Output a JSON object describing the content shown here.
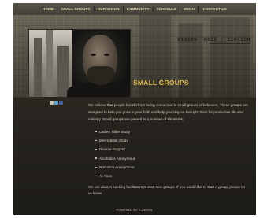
{
  "nav": {
    "items": [
      {
        "label": "HOME"
      },
      {
        "label": "SMALL GROUPS"
      },
      {
        "label": "OUR VISION"
      },
      {
        "label": "COMMUNITY"
      },
      {
        "label": "SCHEDULE"
      },
      {
        "label": "MEDIA"
      },
      {
        "label": "CONTACT US"
      }
    ]
  },
  "brand": {
    "name": "VISION THREE | SIXTEEN"
  },
  "page": {
    "title": "SMALL GROUPS"
  },
  "content": {
    "intro": "We believe that people benefit from being connected to small groups of believers. These groups are designed to help you grow in your faith and help you stay on the right track for productive life and ministry. Small groups are geared to a number of situations:",
    "groups": [
      "Ladies' Bible Study",
      "Men's Bible Study",
      "Divorce Support",
      "Alcoholics Anonymous",
      "Narcotics Anonymous",
      "Al-Anon"
    ],
    "closing": "We are always seeking facilitators to start new groups. If you would like to start a group, please let us know."
  },
  "social": {
    "icons": [
      "email-icon",
      "twitter-icon",
      "facebook-icon"
    ]
  },
  "footer": {
    "text": "POWERED BY E-ZEKIEL"
  },
  "colors": {
    "accent": "#d9b44a",
    "nav_text": "#e8ddb0",
    "background": "#1e1c17"
  }
}
